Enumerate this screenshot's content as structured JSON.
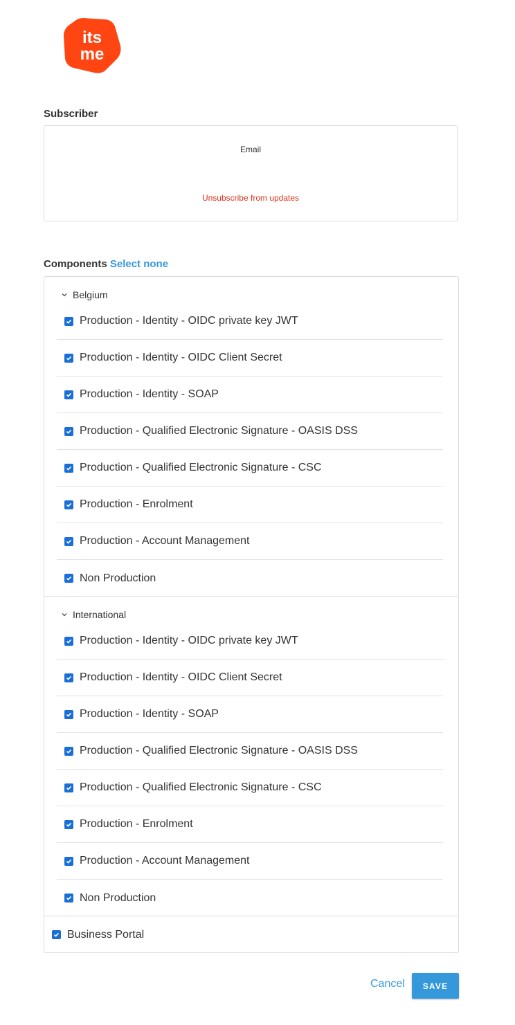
{
  "logo": {
    "text_top": "its",
    "text_bottom": "me",
    "color": "#ff4612"
  },
  "subscriber": {
    "title": "Subscriber",
    "email_label": "Email",
    "unsubscribe_label": "Unsubscribe from updates"
  },
  "components": {
    "title": "Components",
    "select_none_label": "Select none",
    "groups": [
      {
        "name": "Belgium",
        "items": [
          {
            "label": "Production - Identity - OIDC private key JWT",
            "checked": true
          },
          {
            "label": "Production - Identity - OIDC Client Secret",
            "checked": true
          },
          {
            "label": "Production - Identity - SOAP",
            "checked": true
          },
          {
            "label": "Production - Qualified Electronic Signature - OASIS DSS",
            "checked": true
          },
          {
            "label": "Production - Qualified Electronic Signature - CSC",
            "checked": true
          },
          {
            "label": "Production - Enrolment",
            "checked": true
          },
          {
            "label": "Production - Account Management",
            "checked": true
          },
          {
            "label": "Non Production",
            "checked": true
          }
        ]
      },
      {
        "name": "International",
        "items": [
          {
            "label": "Production - Identity - OIDC private key JWT",
            "checked": true
          },
          {
            "label": "Production - Identity - OIDC Client Secret",
            "checked": true
          },
          {
            "label": "Production - Identity - SOAP",
            "checked": true
          },
          {
            "label": "Production - Qualified Electronic Signature - OASIS DSS",
            "checked": true
          },
          {
            "label": "Production - Qualified Electronic Signature - CSC",
            "checked": true
          },
          {
            "label": "Production - Enrolment",
            "checked": true
          },
          {
            "label": "Production - Account Management",
            "checked": true
          },
          {
            "label": "Non Production",
            "checked": true
          }
        ]
      }
    ],
    "standalone": {
      "label": "Business Portal",
      "checked": true
    }
  },
  "actions": {
    "cancel_label": "Cancel",
    "save_label": "SAVE"
  },
  "colors": {
    "accent": "#3498db",
    "checkbox": "#1a6fd6",
    "danger": "#e0311b"
  }
}
